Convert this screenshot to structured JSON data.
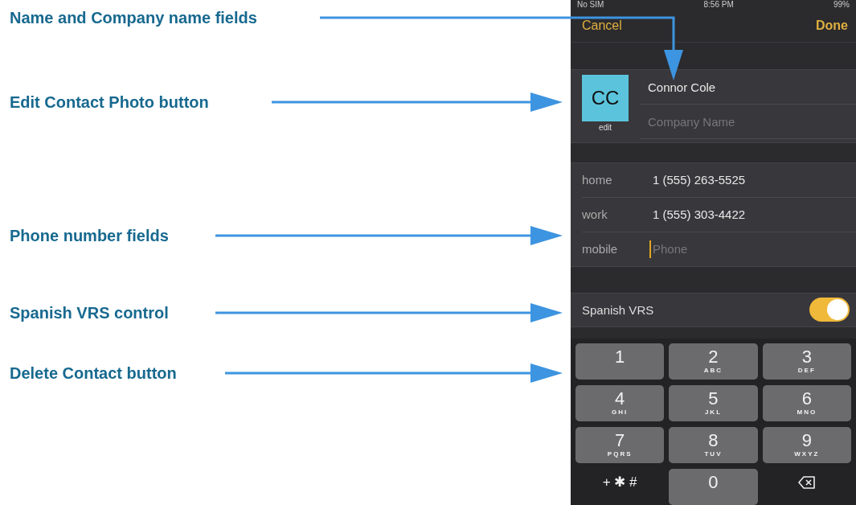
{
  "annotations": [
    {
      "text": "Name and Company name fields",
      "kind": "elbow"
    },
    {
      "text": "Edit Contact Photo button",
      "kind": "straight"
    },
    {
      "text": "Phone number fields",
      "kind": "straight"
    },
    {
      "text": "Spanish VRS control",
      "kind": "straight"
    },
    {
      "text": "Delete Contact button",
      "kind": "straight"
    }
  ],
  "status_bar": {
    "carrier": "No SIM",
    "time": "8:56 PM",
    "battery": "99%"
  },
  "nav": {
    "cancel": "Cancel",
    "done": "Done"
  },
  "contact": {
    "initials": "CC",
    "photo_action": "edit",
    "name": "Connor Cole",
    "company_placeholder": "Company Name"
  },
  "phones": [
    {
      "label": "home",
      "value": "1 (555) 263-5525",
      "focused": false
    },
    {
      "label": "work",
      "value": "1 (555) 303-4422",
      "focused": false
    },
    {
      "label": "mobile",
      "placeholder": "Phone",
      "focused": true
    }
  ],
  "spanish_vrs": {
    "label": "Spanish VRS",
    "on": true
  },
  "keypad": [
    {
      "kind": "digit",
      "digit": "1"
    },
    {
      "kind": "digit",
      "digit": "2",
      "letters": "ABC"
    },
    {
      "kind": "digit",
      "digit": "3",
      "letters": "DEF"
    },
    {
      "kind": "digit",
      "digit": "4",
      "letters": "GHI"
    },
    {
      "kind": "digit",
      "digit": "5",
      "letters": "JKL"
    },
    {
      "kind": "digit",
      "digit": "6",
      "letters": "MNO"
    },
    {
      "kind": "digit",
      "digit": "7",
      "letters": "PQRS"
    },
    {
      "kind": "digit",
      "digit": "8",
      "letters": "TUV"
    },
    {
      "kind": "digit",
      "digit": "9",
      "letters": "WXYZ"
    },
    {
      "kind": "symbols",
      "digit": "+ ✱ #"
    },
    {
      "kind": "digit",
      "digit": "0"
    },
    {
      "kind": "delete"
    }
  ]
}
